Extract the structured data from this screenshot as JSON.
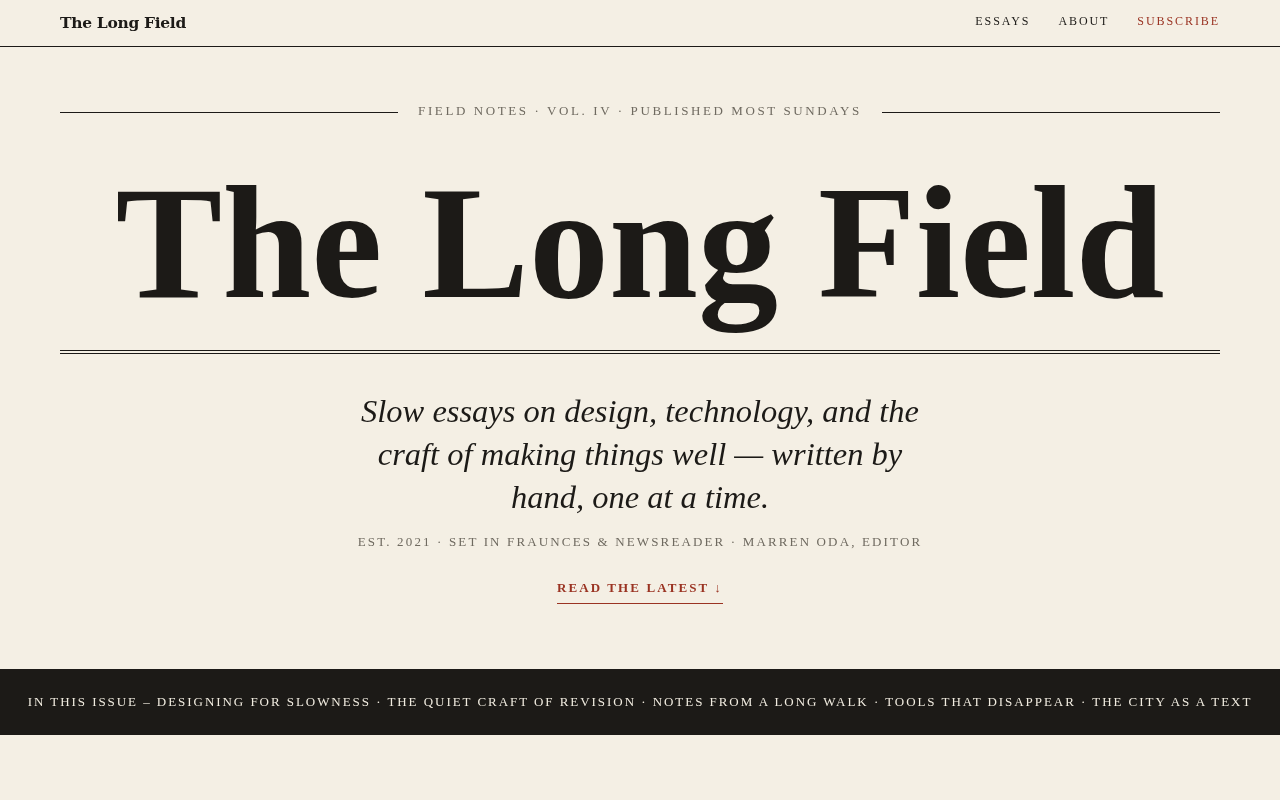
{
  "header": {
    "brand": "The Long Field",
    "nav": [
      {
        "label": "ESSAYS",
        "kind": "link"
      },
      {
        "label": "ABOUT",
        "kind": "link"
      },
      {
        "label": "SUBSCRIBE",
        "kind": "accent"
      }
    ]
  },
  "hero": {
    "kicker": "FIELD NOTES · VOL. IV · PUBLISHED MOST SUNDAYS",
    "title": "The Long Field",
    "tagline": "Slow essays on design, technology, and the craft of making things well — written by hand, one at a time.",
    "meta": "EST. 2021 · SET IN FRAUNCES & NEWSREADER · MARREN ODA, EDITOR",
    "cta": "READ THE LATEST ↓"
  },
  "ticker": {
    "text": "IN THIS ISSUE – DESIGNING FOR SLOWNESS · THE QUIET CRAFT OF REVISION · NOTES FROM A LONG WALK · TOOLS THAT DISAPPEAR · THE CITY AS A TEXT"
  }
}
